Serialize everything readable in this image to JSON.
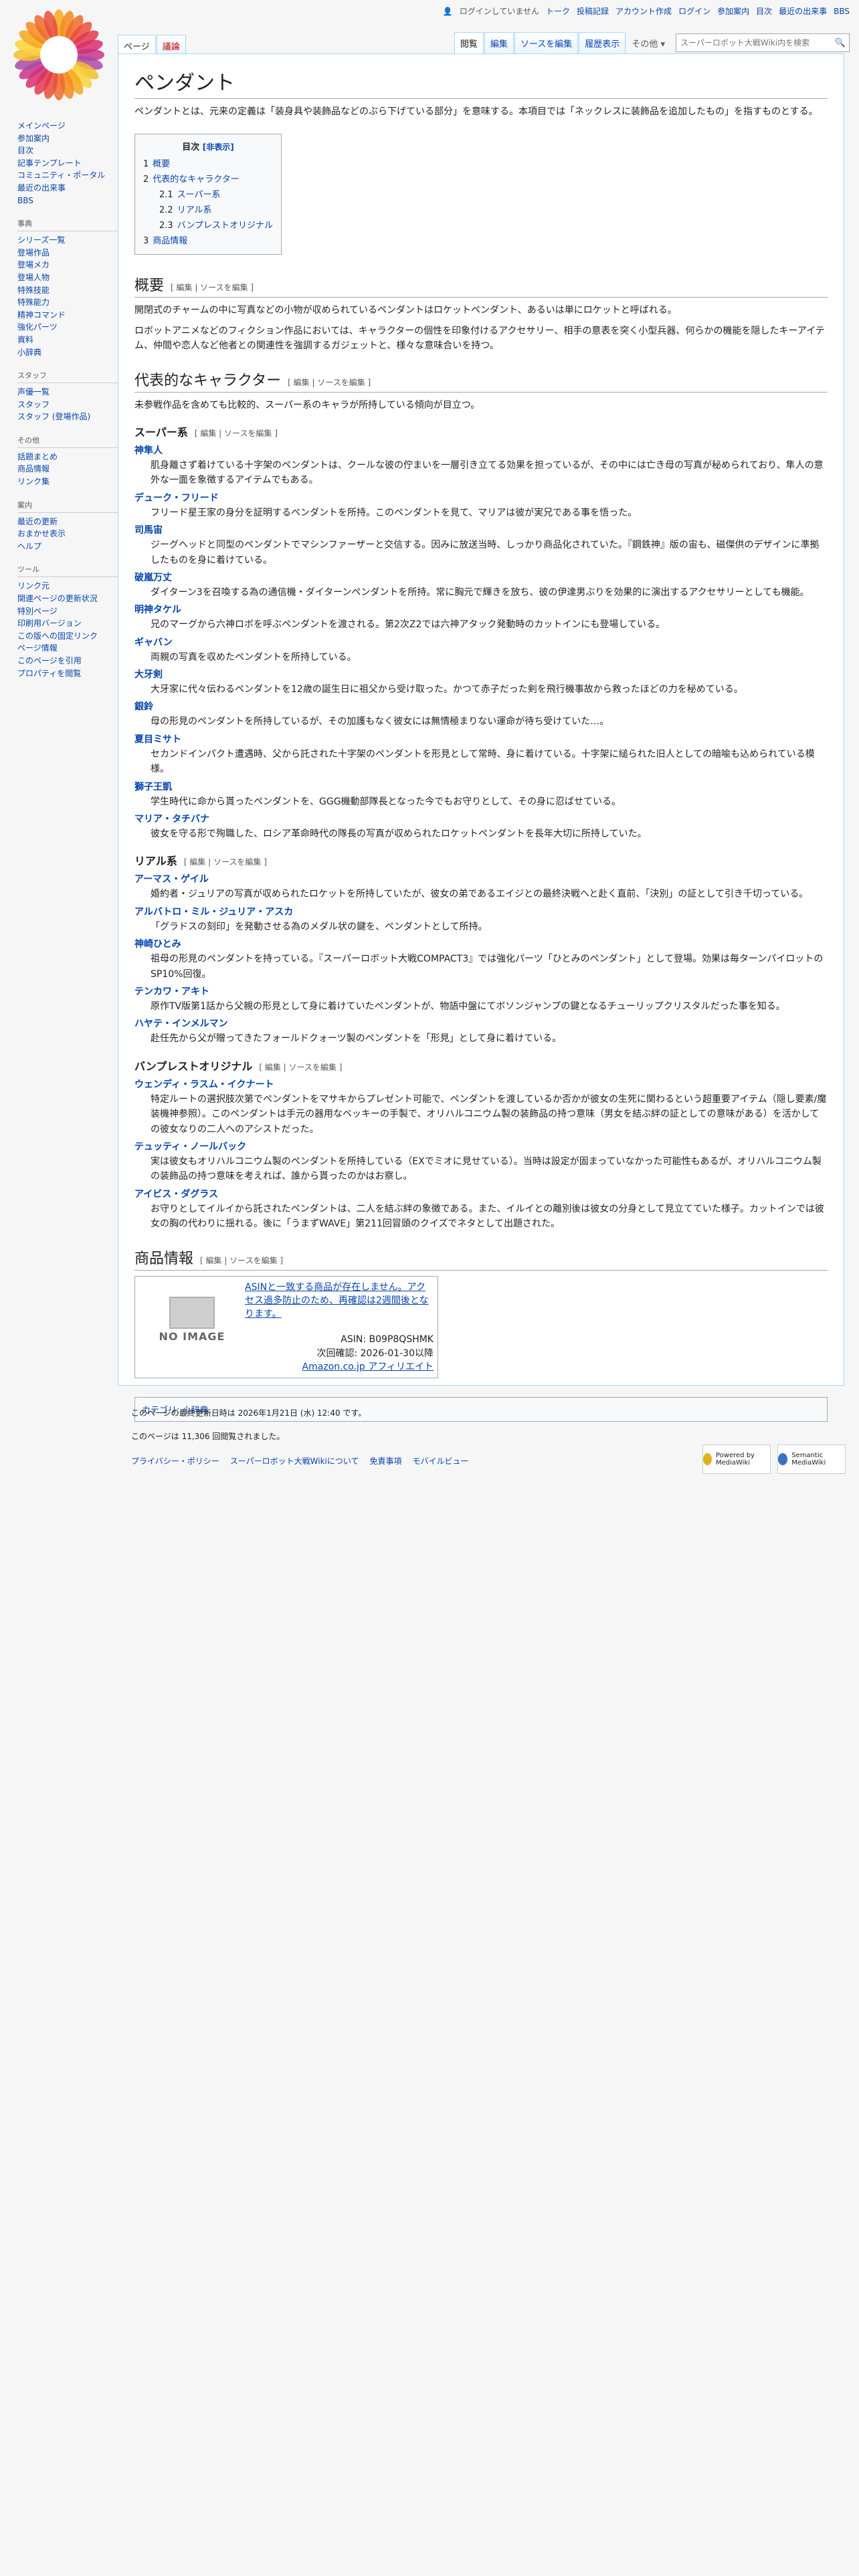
{
  "personal": {
    "not_logged_in": "ログインしていません",
    "talk": "トーク",
    "contribs": "投稿記録",
    "create_account": "アカウント作成",
    "login": "ログイン",
    "participate": "参加案内",
    "toc": "目次",
    "recent": "最近の出来事",
    "bbs": "BBS"
  },
  "tabs": {
    "page": "ページ",
    "talk": "議論",
    "read": "閲覧",
    "edit": "編集",
    "edit_source": "ソースを編集",
    "history": "履歴表示",
    "more": "その他"
  },
  "search": {
    "placeholder": "スーパーロボット大戦Wiki内を検索"
  },
  "sidebar": {
    "nav": [
      "メインページ",
      "参加案内",
      "目次",
      "記事テンプレート",
      "コミュニティ・ポータル",
      "最近の出来事",
      "BBS"
    ],
    "dict_h": "事典",
    "dict": [
      "シリーズ一覧",
      "登場作品",
      "登場メカ",
      "登場人物",
      "特殊技能",
      "特殊能力",
      "精神コマンド",
      "強化パーツ",
      "資料",
      "小辞典"
    ],
    "staff_h": "スタッフ",
    "staff": [
      "声優一覧",
      "スタッフ",
      "スタッフ (登場作品)"
    ],
    "other_h": "その他",
    "other": [
      "話題まとめ",
      "商品情報",
      "リンク集"
    ],
    "nav2_h": "案内",
    "nav2": [
      "最近の更新",
      "おまかせ表示",
      "ヘルプ"
    ],
    "tools_h": "ツール",
    "tools": [
      "リンク元",
      "関連ページの更新状況",
      "特別ページ",
      "印刷用バージョン",
      "この版への固定リンク",
      "ページ情報",
      "このページを引用",
      "プロパティを閲覧"
    ]
  },
  "article": {
    "title": "ペンダント",
    "intro": "ペンダントとは、元来の定義は「装身具や装飾品などのぶら下げている部分」を意味する。本項目では「ネックレスに装飾品を追加したもの」を指すものとする。",
    "toc_title": "目次",
    "toc_toggle": "[非表示]",
    "toc": [
      {
        "num": "1",
        "label": "概要",
        "sub": false
      },
      {
        "num": "2",
        "label": "代表的なキャラクター",
        "sub": false
      },
      {
        "num": "2.1",
        "label": "スーパー系",
        "sub": true
      },
      {
        "num": "2.2",
        "label": "リアル系",
        "sub": true
      },
      {
        "num": "2.3",
        "label": "バンプレストオリジナル",
        "sub": true
      },
      {
        "num": "3",
        "label": "商品情報",
        "sub": false
      }
    ],
    "edit_label": "[ 編集 | ソースを編集 ]",
    "h_overview": "概要",
    "overview_p1": "開閉式のチャームの中に写真などの小物が収められているペンダントはロケットペンダント、あるいは単にロケットと呼ばれる。",
    "overview_p2": "ロボットアニメなどのフィクション作品においては、キャラクターの個性を印象付けるアクセサリー、相手の意表を突く小型兵器、何らかの機能を隠したキーアイテム、仲間や恋人など他者との関連性を強調するガジェットと、様々な意味合いを持つ。",
    "h_chars": "代表的なキャラクター",
    "chars_p": "未参戦作品を含めても比較的、スーパー系のキャラが所持している傾向が目立つ。",
    "h_super": "スーパー系",
    "super": [
      {
        "name": "神隼人",
        "desc": "肌身離さず着けている十字架のペンダントは、クールな彼の佇まいを一層引き立てる効果を担っているが、その中には亡き母の写真が秘められており、隼人の意外な一面を象徴するアイテムでもある。"
      },
      {
        "name": "デューク・フリード",
        "desc": "フリード星王家の身分を証明するペンダントを所持。このペンダントを見て、マリアは彼が実兄である事を悟った。"
      },
      {
        "name": "司馬宙",
        "desc": "ジーグヘッドと同型のペンダントでマシンファーザーと交信する。因みに放送当時、しっかり商品化されていた。『鋼鉄神』版の宙も、磁傑供のデザインに準拠したものを身に着けている。"
      },
      {
        "name": "破嵐万丈",
        "desc": "ダイターン3を召喚する為の通信機・ダイターンペンダントを所持。常に胸元で輝きを放ち、彼の伊達男ぶりを効果的に演出するアクセサリーとしても機能。"
      },
      {
        "name": "明神タケル",
        "desc": "兄のマーグから六神ロボを呼ぶペンダントを渡される。第2次Z2では六神アタック発動時のカットインにも登場している。"
      },
      {
        "name": "ギャバン",
        "desc": "両親の写真を収めたペンダントを所持している。"
      },
      {
        "name": "大牙剣",
        "desc": "大牙家に代々伝わるペンダントを12歳の誕生日に祖父から受け取った。かつて赤子だった剣を飛行機事故から救ったほどの力を秘めている。"
      },
      {
        "name": "銀鈴",
        "desc": "母の形見のペンダントを所持しているが、その加護もなく彼女には無情極まりない運命が待ち受けていた…。"
      },
      {
        "name": "夏目ミサト",
        "desc": "セカンドインパクト遭遇時、父から託された十字架のペンダントを形見として常時、身に着けている。十字架に縋られた旧人としての暗喩も込められている模様。"
      },
      {
        "name": "獅子王凱",
        "desc": "学生時代に命から貰ったペンダントを、GGG機動部隊長となった今でもお守りとして、その身に忍ばせている。"
      },
      {
        "name": "マリア・タチバナ",
        "desc": "彼女を守る形で殉職した、ロシア革命時代の隊長の写真が収められたロケットペンダントを長年大切に所持していた。"
      }
    ],
    "h_real": "リアル系",
    "real": [
      {
        "name": "アーマス・ゲイル",
        "desc": "婚約者・ジュリアの写真が収められたロケットを所持していたが、彼女の弟であるエイジとの最終決戦へと赴く直前、「決別」の証として引き千切っている。"
      },
      {
        "name": "アルバトロ・ミル・ジュリア・アスカ",
        "desc": "「グラドスの刻印」を発動させる為のメダル状の鍵を、ペンダントとして所持。"
      },
      {
        "name": "神崎ひとみ",
        "desc": "祖母の形見のペンダントを持っている。『スーパーロボット大戦COMPACT3』では強化パーツ「ひとみのペンダント」として登場。効果は毎ターンパイロットのSP10%回復。"
      },
      {
        "name": "テンカワ・アキト",
        "desc": "原作TV版第1話から父親の形見として身に着けていたペンダントが、物語中盤にてボソンジャンプの鍵となるチューリップクリスタルだった事を知る。"
      },
      {
        "name": "ハヤテ・インメルマン",
        "desc": "赴任先から父が贈ってきたフォールドクォーツ製のペンダントを「形見」として身に着けている。"
      }
    ],
    "h_orig": "バンプレストオリジナル",
    "orig": [
      {
        "name": "ウェンディ・ラスム・イクナート",
        "desc": "特定ルートの選択肢次第でペンダントをマサキからプレゼント可能で、ペンダントを渡しているか否かが彼女の生死に関わるという超重要アイテム（隠し要素/魔装機神参照）。このペンダントは手元の器用なベッキーの手製で、オリハルコニウム製の装飾品の持つ意味（男女を結ぶ絆の証としての意味がある）を活かしての彼女なりの二人へのアシストだった。"
      },
      {
        "name": "テュッティ・ノールバック",
        "desc": "実は彼女もオリハルコニウム製のペンダントを所持している（EXでミオに見せている）。当時は設定が固まっていなかった可能性もあるが、オリハルコニウム製の装飾品の持つ意味を考えれば、誰から貰ったのかはお察し。"
      },
      {
        "name": "アイビス・ダグラス",
        "desc": "お守りとしてイルイから託されたペンダントは、二人を結ぶ絆の象徴である。また、イルイとの離別後は彼女の分身として見立てていた様子。カットインでは彼女の胸の代わりに揺れる。後に「うまずWAVE」第211回冒頭のクイズでネタとして出題された。"
      }
    ],
    "h_product": "商品情報",
    "product": {
      "noimage": "NO IMAGE",
      "notice": "ASINと一致する商品が存在しません。アクセス過多防止のため、再確認は2週間後となります。",
      "asin": "ASIN: B09P8QSHMK",
      "recheck": "次回確認: 2026-01-30以降",
      "aff": "Amazon.co.jp アフィリエイト"
    },
    "categories": "カテゴリ: 小辞典"
  },
  "footer": {
    "lastmod": "このページの最終更新日時は 2026年1月21日 (水) 12:40 です。",
    "views": "このページは 11,306 回閲覧されました。",
    "privacy": "プライバシー・ポリシー",
    "about": "スーパーロボット大戦Wikiについて",
    "disclaimer": "免責事項",
    "mobile": "モバイルビュー",
    "badge1": "Powered by MediaWiki",
    "badge2": "Semantic MediaWiki"
  }
}
